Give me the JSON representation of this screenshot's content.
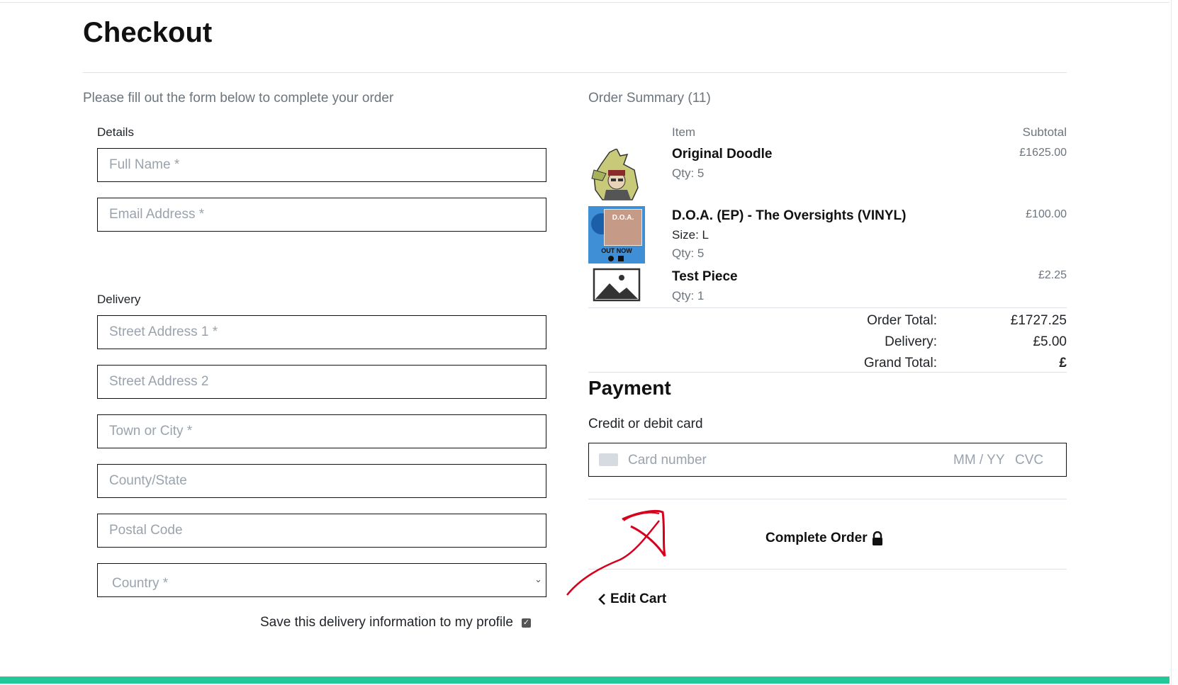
{
  "page": {
    "title": "Checkout",
    "intro": "Please fill out the form below to complete your order",
    "summary_heading": "Order Summary (11)"
  },
  "details": {
    "label": "Details",
    "full_name_placeholder": "Full Name *",
    "email_placeholder": "Email Address *"
  },
  "delivery": {
    "label": "Delivery",
    "street1_placeholder": "Street Address 1 *",
    "street2_placeholder": "Street Address 2",
    "town_placeholder": "Town or City *",
    "county_placeholder": "County/State",
    "postcode_placeholder": "Postal Code",
    "country_placeholder": "Country *",
    "save_label": "Save this delivery information to my profile",
    "save_checked": true
  },
  "summary": {
    "col_item": "Item",
    "col_subtotal": "Subtotal",
    "items": [
      {
        "name": "Original Doodle",
        "qty": "Qty: 5",
        "price": "£1625.00"
      },
      {
        "name": "D.O.A. (EP) - The Oversights (VINYL)",
        "size": "Size: L",
        "qty": "Qty: 5",
        "price": "£100.00",
        "img_text_1": "D.O.A.",
        "img_text_2": "OUT NOW"
      },
      {
        "name": "Test Piece",
        "qty": "Qty: 1",
        "price": "£2.25"
      }
    ],
    "order_total_label": "Order Total:",
    "order_total": "£1727.25",
    "delivery_label": "Delivery:",
    "delivery_value": "£5.00",
    "grand_total_label": "Grand Total:",
    "grand_total": "£"
  },
  "payment": {
    "heading": "Payment",
    "card_label": "Credit or debit card",
    "card_placeholder": "Card number",
    "expiry_placeholder": "MM / YY",
    "cvc_placeholder": "CVC"
  },
  "actions": {
    "complete_label": "Complete Order",
    "edit_label": "Edit Cart"
  },
  "colors": {
    "accent": "#20c997",
    "annotation": "#d6001c"
  }
}
